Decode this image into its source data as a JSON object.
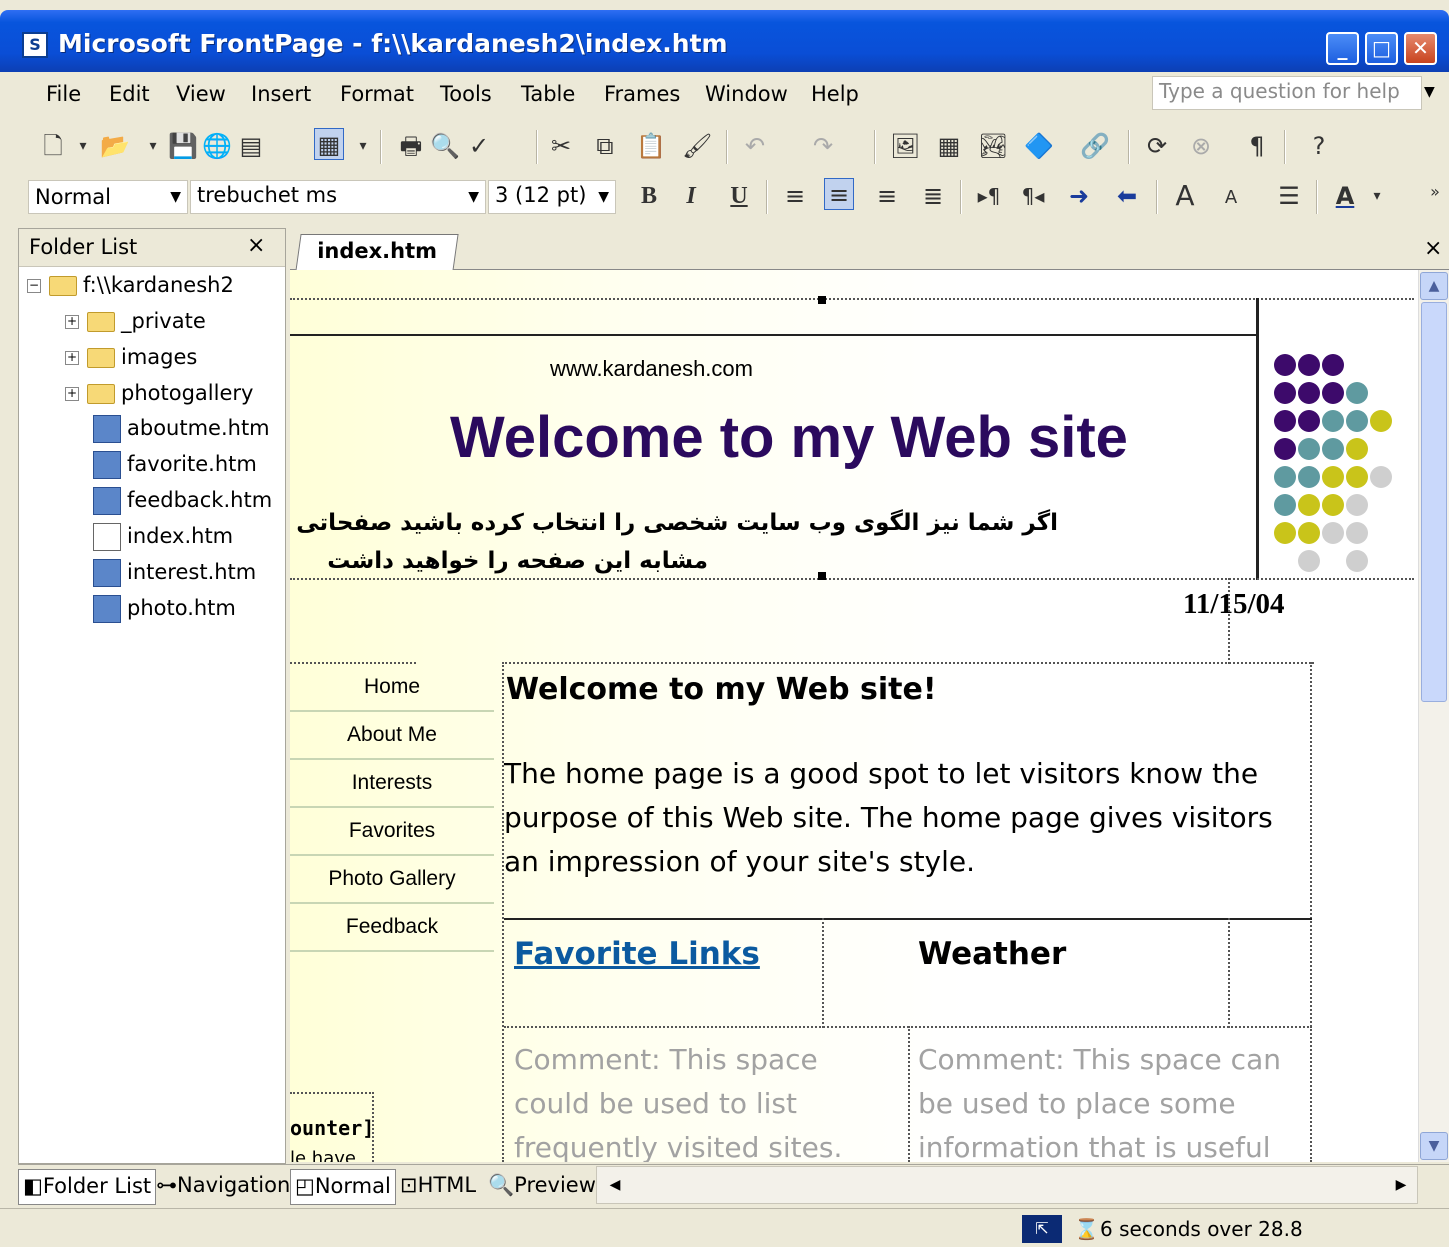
{
  "window": {
    "title": "Microsoft FrontPage - f:\\\\kardanesh2\\index.htm",
    "minimize": "_",
    "maximize": "□",
    "close": "✕"
  },
  "menu": {
    "items": [
      "File",
      "Edit",
      "View",
      "Insert",
      "Format",
      "Tools",
      "Table",
      "Frames",
      "Window",
      "Help"
    ],
    "help_placeholder": "Type a question for help"
  },
  "format_toolbar": {
    "style": "Normal",
    "font": "trebuchet ms",
    "size": "3  (12 pt)",
    "bold": "B",
    "italic": "I",
    "underline": "U"
  },
  "folder_list": {
    "title": "Folder List",
    "close": "×",
    "root": "f:\\\\kardanesh2",
    "items": [
      {
        "name": "_private",
        "type": "folder"
      },
      {
        "name": "images",
        "type": "folder"
      },
      {
        "name": "photogallery",
        "type": "folder"
      },
      {
        "name": "aboutme.htm",
        "type": "page"
      },
      {
        "name": "favorite.htm",
        "type": "page"
      },
      {
        "name": "feedback.htm",
        "type": "page"
      },
      {
        "name": "index.htm",
        "type": "page-edit"
      },
      {
        "name": "interest.htm",
        "type": "page"
      },
      {
        "name": "photo.htm",
        "type": "page"
      }
    ]
  },
  "editor": {
    "tab": "index.htm",
    "close": "×",
    "site_url": "www.kardanesh.com",
    "banner_title": "Welcome to my Web site",
    "farsi_line1": "اگر شما نیز الگوی وب سایت شخصی را انتخاب کرده باشید صفحاتی",
    "farsi_line2": "مشابه این صفحه را خواهید داشت",
    "date": "11/15/04",
    "nav": [
      "Home",
      "About Me",
      "Interests",
      "Favorites",
      "Photo Gallery",
      "Feedback"
    ],
    "heading": "Welcome to my Web site!",
    "paragraph": "The home page is a good spot to let visitors know the purpose of this Web site. The home page gives visitors an impression of your site's style.",
    "favorite_links": "Favorite Links",
    "weather": "Weather",
    "comment_left": "Comment: This space could be used to list frequently visited sites.",
    "comment_right": "Comment: This space can be used to place some information that is useful",
    "counter": "ounter]",
    "counter_note": "le have"
  },
  "view_tabs": {
    "folder_list": "Folder List",
    "navigation": "Navigation",
    "normal": "Normal",
    "html": "HTML",
    "preview": "Preview"
  },
  "status": {
    "text": "6 seconds over 28.8"
  },
  "colors": {
    "title_bar": "#0a4ed6",
    "heading_purple": "#2b0a5e",
    "link_blue": "#0b5aa0",
    "dot_purple": "#3d0a6b",
    "dot_teal": "#5f9aa0",
    "dot_yellow": "#c9c41a",
    "dot_grey": "#cfcfcf"
  }
}
